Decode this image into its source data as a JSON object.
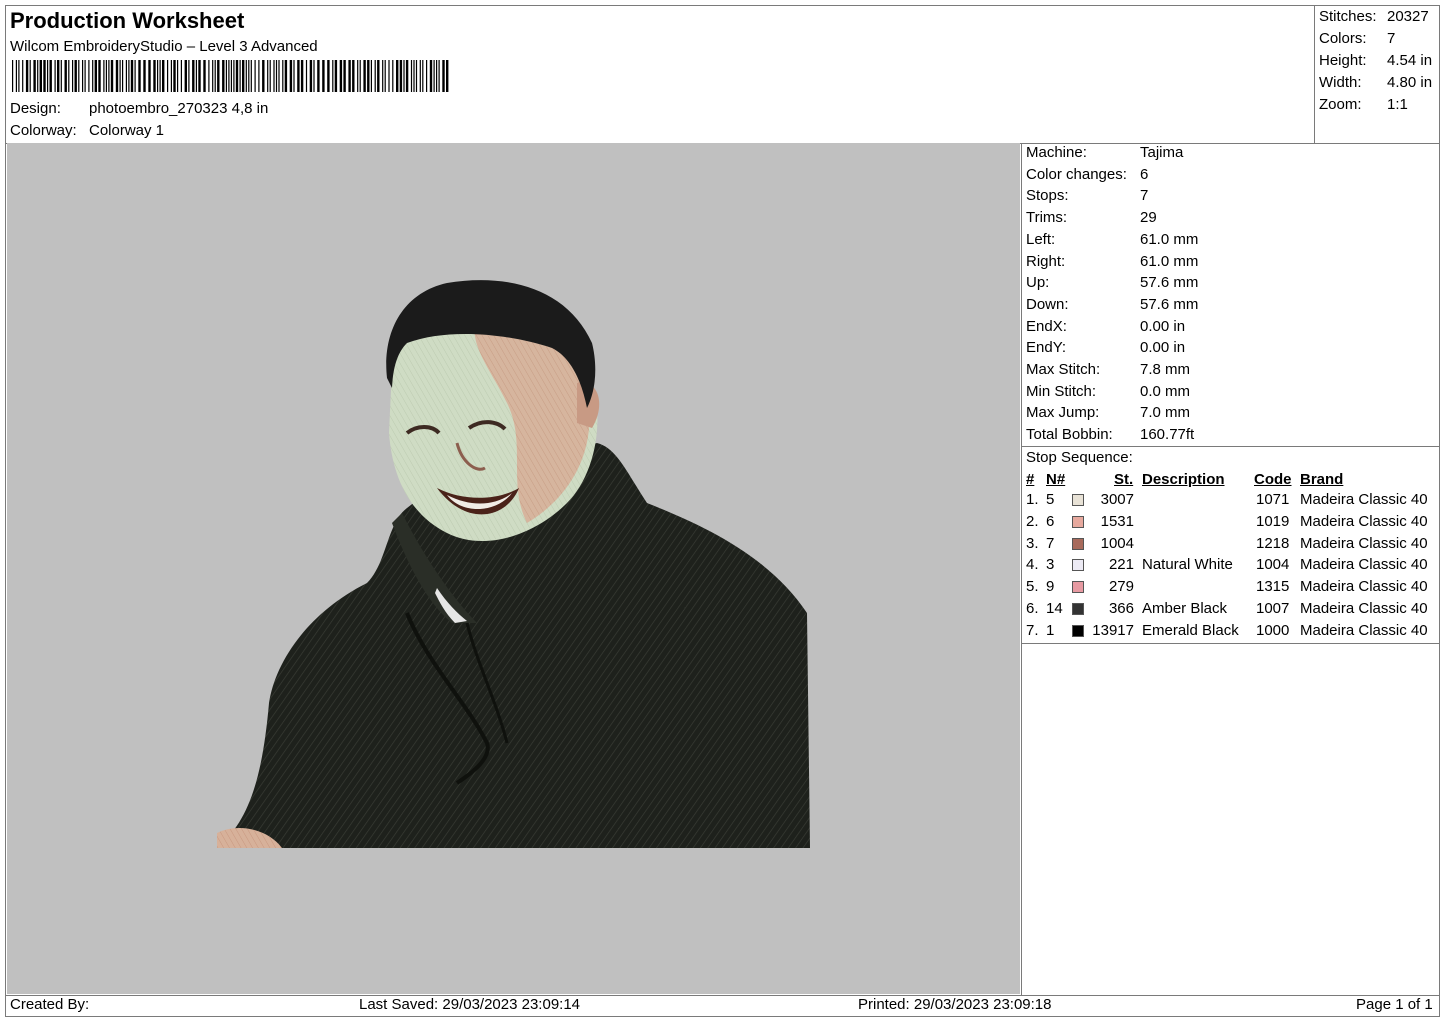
{
  "header": {
    "title": "Production Worksheet",
    "software": "Wilcom EmbroideryStudio – Level 3 Advanced",
    "barcode_icon": "barcode",
    "design_label": "Design:",
    "design_value": "photoembro_270323 4,8 in",
    "colorway_label": "Colorway:",
    "colorway_value": "Colorway 1"
  },
  "summary": [
    {
      "label": "Stitches:",
      "value": "20327"
    },
    {
      "label": "Colors:",
      "value": "7"
    },
    {
      "label": "Height:",
      "value": "4.54 in"
    },
    {
      "label": "Width:",
      "value": "4.80 in"
    },
    {
      "label": "Zoom:",
      "value": "1:1"
    }
  ],
  "machine_info": [
    {
      "label": "Machine:",
      "value": "Tajima"
    },
    {
      "label": "Color changes:",
      "value": "6"
    },
    {
      "label": "Stops:",
      "value": "7"
    },
    {
      "label": "Trims:",
      "value": "29"
    },
    {
      "label": "Left:",
      "value": "61.0 mm"
    },
    {
      "label": "Right:",
      "value": "61.0 mm"
    },
    {
      "label": "Up:",
      "value": "57.6 mm"
    },
    {
      "label": "Down:",
      "value": "57.6 mm"
    },
    {
      "label": "EndX:",
      "value": "0.00 in"
    },
    {
      "label": "EndY:",
      "value": "0.00 in"
    },
    {
      "label": "Max Stitch:",
      "value": "7.8 mm"
    },
    {
      "label": "Min Stitch:",
      "value": "0.0 mm"
    },
    {
      "label": "Max Jump:",
      "value": "7.0 mm"
    },
    {
      "label": "Total Bobbin:",
      "value": "160.77ft"
    }
  ],
  "stop_sequence": {
    "title": "Stop Sequence:",
    "columns": {
      "num": "#",
      "n": "N#",
      "st": "St.",
      "description": "Description",
      "code": "Code",
      "brand": "Brand"
    },
    "rows": [
      {
        "num": "1.",
        "n": "5",
        "color": "#e8e2d6",
        "st": "3007",
        "description": "",
        "code": "1071",
        "brand": "Madeira Classic 40"
      },
      {
        "num": "2.",
        "n": "6",
        "color": "#e7a99e",
        "st": "1531",
        "description": "",
        "code": "1019",
        "brand": "Madeira Classic 40"
      },
      {
        "num": "3.",
        "n": "7",
        "color": "#a86a5c",
        "st": "1004",
        "description": "",
        "code": "1218",
        "brand": "Madeira Classic 40"
      },
      {
        "num": "4.",
        "n": "3",
        "color": "#eceaf4",
        "st": "221",
        "description": "Natural White",
        "code": "1004",
        "brand": "Madeira Classic 40"
      },
      {
        "num": "5.",
        "n": "9",
        "color": "#e79aa2",
        "st": "279",
        "description": "",
        "code": "1315",
        "brand": "Madeira Classic 40"
      },
      {
        "num": "6.",
        "n": "14",
        "color": "#333333",
        "st": "366",
        "description": "Amber Black",
        "code": "1007",
        "brand": "Madeira Classic 40"
      },
      {
        "num": "7.",
        "n": "1",
        "color": "#000000",
        "st": "13917",
        "description": "Emerald Black",
        "code": "1000",
        "brand": "Madeira Classic 40"
      }
    ]
  },
  "footer": {
    "created_by": "Created By:",
    "last_saved": "Last Saved: 29/03/2023 23:09:14",
    "printed": "Printed: 29/03/2023 23:09:18",
    "page": "Page 1 of 1"
  },
  "colors": {
    "canvas_bg": "#c0c0c0",
    "hoodie": "#1e211c",
    "skin_light": "#cfdcc4",
    "skin": "#d9ab93",
    "hair": "#1b1b1b"
  }
}
